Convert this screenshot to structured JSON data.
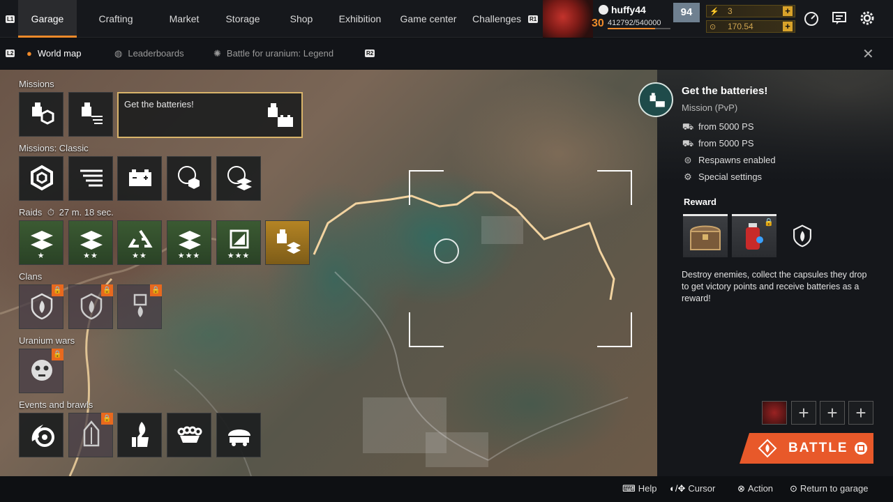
{
  "topbar": {
    "tabs": [
      "Garage",
      "Crafting",
      "Market",
      "Storage",
      "Shop",
      "Exhibition",
      "Game center",
      "Challenges"
    ],
    "left_badge": "L1",
    "right_badge": "R1",
    "user": {
      "name": "huffy44",
      "level": "30",
      "xp": "412792/540000",
      "xp_progress": 0.76,
      "rank": "94"
    },
    "currency": [
      {
        "value": "3",
        "icon": "coin-icon"
      },
      {
        "value": "170.54",
        "icon": "gold-icon"
      }
    ],
    "icons": [
      "speedometer-icon",
      "chat-icon",
      "gear-icon"
    ]
  },
  "subbar": {
    "left_badge": "L2",
    "right_badge": "R2",
    "tabs": [
      "World map",
      "Leaderboards",
      "Battle for uranium: Legend"
    ],
    "close": "✕"
  },
  "sections": {
    "missions": "Missions",
    "missions_classic": "Missions: Classic",
    "raids": "Raids",
    "raids_timer": "27 m. 18 sec.",
    "clans": "Clans",
    "uranium_wars": "Uranium wars",
    "events": "Events and brawls"
  },
  "selected_mission_label": "Get the batteries!",
  "mission_panel": {
    "title": "Get the batteries!",
    "type": "Mission (PvP)",
    "props": [
      {
        "icon": "car-icon",
        "text": "from 5000 PS"
      },
      {
        "icon": "car-icon",
        "text": "from 5000 PS"
      },
      {
        "icon": "respawn-icon",
        "text": "Respawns enabled"
      },
      {
        "icon": "settings-icon",
        "text": "Special settings"
      }
    ],
    "reward_label": "Reward",
    "description": "Destroy enemies, collect the capsules they drop to get victory points and receive batteries as a reward!",
    "battle_label": "BATTLE"
  },
  "raid_stars": [
    "★",
    "★★",
    "★★",
    "★★★",
    "★★★",
    ""
  ],
  "slot_plus": "+",
  "hints": [
    {
      "icon": "⌨",
      "label": "Help"
    },
    {
      "icon": "◐/✥",
      "label": "Cursor"
    },
    {
      "icon": "⊗",
      "label": "Action"
    },
    {
      "icon": "⊙",
      "label": "Return to garage"
    }
  ],
  "colors": {
    "accent": "#f08a2a",
    "battle": "#e8592a",
    "selected_border": "#d9b46a",
    "route": "#f2d3a0"
  }
}
